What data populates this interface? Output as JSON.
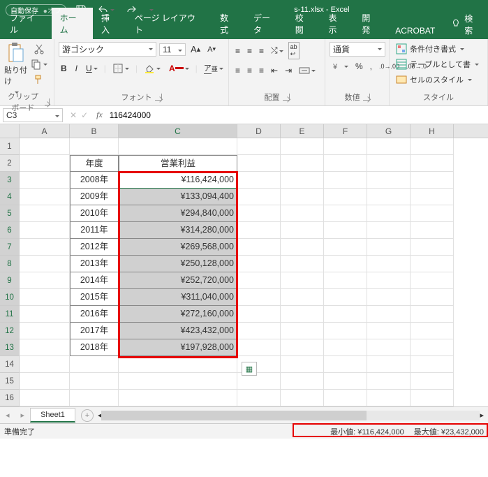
{
  "titlebar": {
    "autosave": "自動保存",
    "autosave_state": "オフ",
    "filename": "s-11.xlsx  -  Excel"
  },
  "tabs": {
    "file": "ファイル",
    "home": "ホーム",
    "insert": "挿入",
    "pagelayout": "ページ レイアウト",
    "formulas": "数式",
    "data": "データ",
    "review": "校閲",
    "view": "表示",
    "dev": "開発",
    "acrobat": "ACROBAT",
    "search": "検索"
  },
  "ribbon": {
    "clipboard": "クリップボード",
    "paste": "貼り付け",
    "font_group": "フォント",
    "font_name": "游ゴシック",
    "font_size": "11",
    "align_group": "配置",
    "wrap": "ab",
    "number_group": "数値",
    "number_format": "通貨",
    "styles_group": "スタイル",
    "cond": "条件付き書式",
    "table": "テーブルとして書",
    "cell": "セルのスタイル"
  },
  "namebox": "C3",
  "formula": "116424000",
  "columns": [
    "A",
    "B",
    "C",
    "D",
    "E",
    "F",
    "G",
    "H"
  ],
  "headerB": "年度",
  "headerC": "営業利益",
  "rows": [
    {
      "b": "2008年",
      "c": "¥116,424,000"
    },
    {
      "b": "2009年",
      "c": "¥133,094,400"
    },
    {
      "b": "2010年",
      "c": "¥294,840,000"
    },
    {
      "b": "2011年",
      "c": "¥314,280,000"
    },
    {
      "b": "2012年",
      "c": "¥269,568,000"
    },
    {
      "b": "2013年",
      "c": "¥250,128,000"
    },
    {
      "b": "2014年",
      "c": "¥252,720,000"
    },
    {
      "b": "2015年",
      "c": "¥311,040,000"
    },
    {
      "b": "2016年",
      "c": "¥272,160,000"
    },
    {
      "b": "2017年",
      "c": "¥423,432,000"
    },
    {
      "b": "2018年",
      "c": "¥197,928,000"
    }
  ],
  "sheet_tab": "Sheet1",
  "status": {
    "ready": "準備完了",
    "min_label": "最小値:",
    "min": "¥116,424,000",
    "max_label": "最大値:",
    "max": "¥23,432,000"
  },
  "chart_data": {
    "type": "table",
    "title": "営業利益",
    "categories": [
      "2008年",
      "2009年",
      "2010年",
      "2011年",
      "2012年",
      "2013年",
      "2014年",
      "2015年",
      "2016年",
      "2017年",
      "2018年"
    ],
    "values": [
      116424000,
      133094400,
      294840000,
      314280000,
      269568000,
      250128000,
      252720000,
      311040000,
      272160000,
      423432000,
      197928000
    ],
    "xlabel": "年度",
    "ylabel": "営業利益"
  }
}
